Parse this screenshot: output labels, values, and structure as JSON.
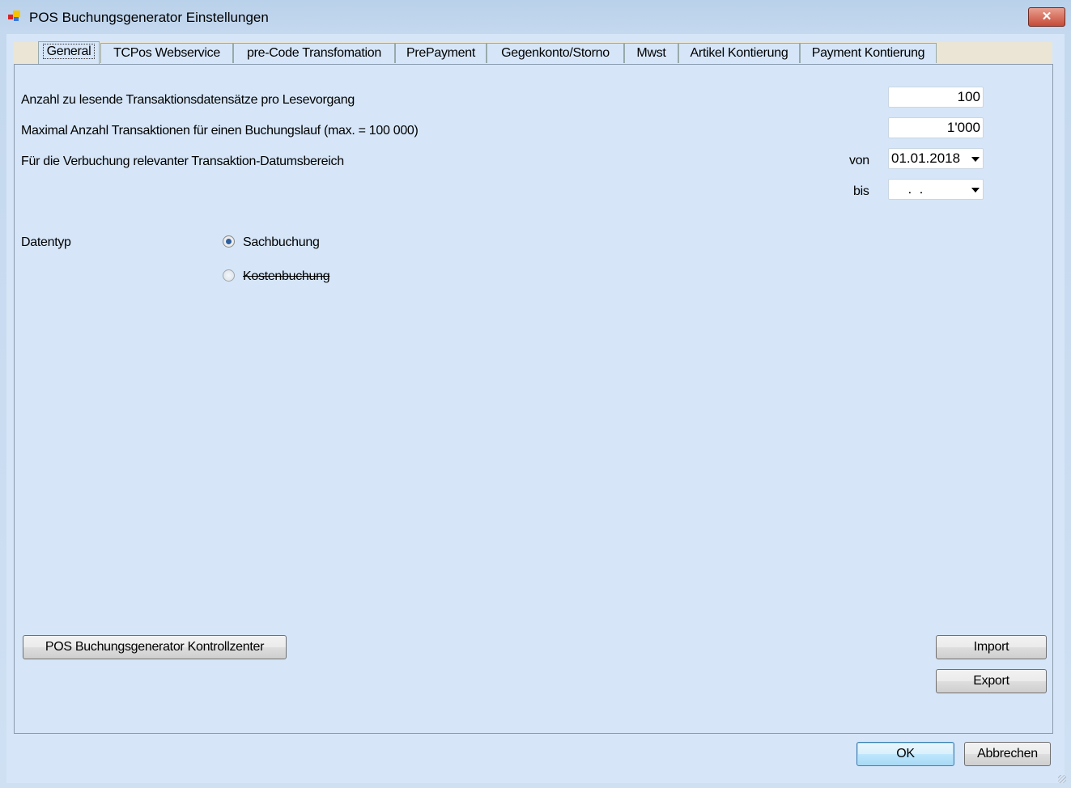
{
  "window": {
    "title": "POS Buchungsgenerator Einstellungen",
    "close_label": "✕"
  },
  "tabs": [
    {
      "label": "General"
    },
    {
      "label": "TCPos Webservice"
    },
    {
      "label": "pre-Code Transfomation"
    },
    {
      "label": "PrePayment"
    },
    {
      "label": "Gegenkonto/Storno"
    },
    {
      "label": "Mwst"
    },
    {
      "label": "Artikel Kontierung"
    },
    {
      "label": "Payment Kontierung"
    }
  ],
  "general": {
    "batch_size_label": "Anzahl zu lesende Transaktionsdatensätze pro Lesevorgang",
    "batch_size_value": "100",
    "max_tx_label": "Maximal Anzahl Transaktionen für einen Buchungslauf (max. = 100 000)",
    "max_tx_value": "1'000",
    "date_range_label": "Für die Verbuchung relevanter Transaktion-Datumsbereich",
    "from_label": "von",
    "from_value": "01.01.2018",
    "to_label": "bis",
    "to_value": "  .  .",
    "datatype_label": "Datentyp",
    "option_sach": "Sachbuchung",
    "option_kosten": "Kostenbuchung",
    "selected": "Sachbuchung",
    "control_center_button": "POS Buchungsgenerator Kontrollzenter",
    "import_button": "Import",
    "export_button": "Export"
  },
  "footer": {
    "ok": "OK",
    "cancel": "Abbrechen"
  }
}
